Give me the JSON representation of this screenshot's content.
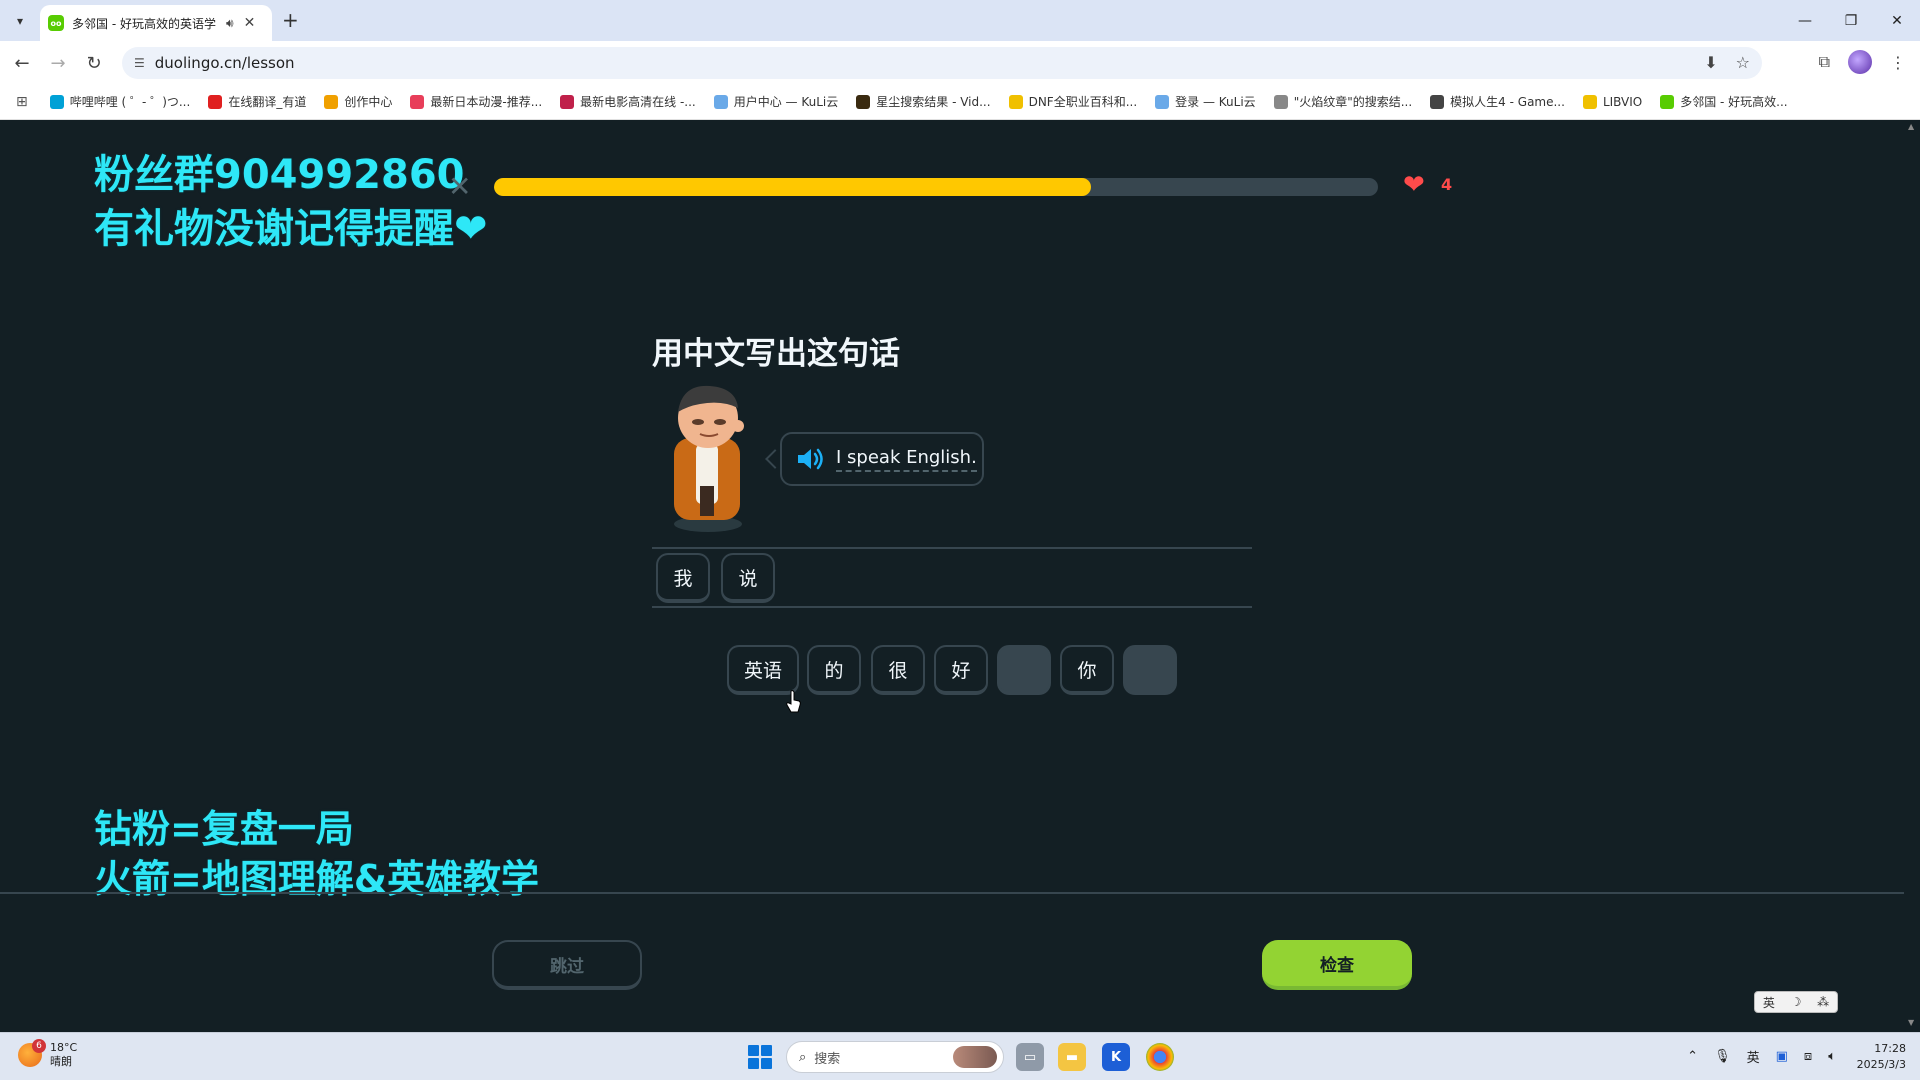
{
  "browser": {
    "tab_title": "多邻国 - 好玩高效的英语学",
    "favicon_text": "oo",
    "url": "duolingo.cn/lesson",
    "bookmarks": [
      {
        "label": "哔哩哔哩 ( ゜- ゜)つ...",
        "color": "#00a1d6"
      },
      {
        "label": "在线翻译_有道",
        "color": "#e02020"
      },
      {
        "label": "创作中心",
        "color": "#f0a000"
      },
      {
        "label": "最新日本动漫-推荐...",
        "color": "#e83e5a"
      },
      {
        "label": "最新电影高清在线 -...",
        "color": "#c0204a"
      },
      {
        "label": "用户中心 — KuLi云",
        "color": "#6aa9e8"
      },
      {
        "label": "星尘搜索结果 - Vid...",
        "color": "#3a2a10"
      },
      {
        "label": "DNF全职业百科和...",
        "color": "#f0c000"
      },
      {
        "label": "登录 — KuLi云",
        "color": "#6aa9e8"
      },
      {
        "label": "\"火焰纹章\"的搜索结...",
        "color": "#888888"
      },
      {
        "label": "模拟人生4 - Game...",
        "color": "#444444"
      },
      {
        "label": "LIBVIO",
        "color": "#f0c000"
      },
      {
        "label": "多邻国 - 好玩高效...",
        "color": "#58cc02"
      }
    ]
  },
  "overlay": {
    "line1": "粉丝群904992860",
    "line2": "有礼物没谢记得提醒❤",
    "line3": "钻粉=复盘一局",
    "line4": "火箭=地图理解&英雄教学"
  },
  "lesson": {
    "progress_fraction": 0.675,
    "hearts": "4",
    "prompt": "用中文写出这句话",
    "sentence": "I speak English.",
    "answer_tiles": [
      "我",
      "说"
    ],
    "word_bank": [
      {
        "text": "英语",
        "used": false
      },
      {
        "text": "的",
        "used": false
      },
      {
        "text": "很",
        "used": false
      },
      {
        "text": "好",
        "used": false
      },
      {
        "text": "",
        "used": true
      },
      {
        "text": "你",
        "used": false
      },
      {
        "text": "",
        "used": true
      }
    ],
    "skip_label": "跳过",
    "check_label": "检查"
  },
  "ime": {
    "label1": "英",
    "label2": "☽",
    "label3": "⁂"
  },
  "taskbar": {
    "weather_badge": "6",
    "temperature": "18°C",
    "weather_desc": "晴朗",
    "search_placeholder": "搜索",
    "tray_lang": "英",
    "time": "17:28",
    "date": "2025/3/3"
  },
  "colors": {
    "background": "#131f24",
    "progress": "#ffc800",
    "check_button": "#93d333",
    "overlay_text": "#2ee7f7",
    "heart": "#ff4b4b"
  }
}
